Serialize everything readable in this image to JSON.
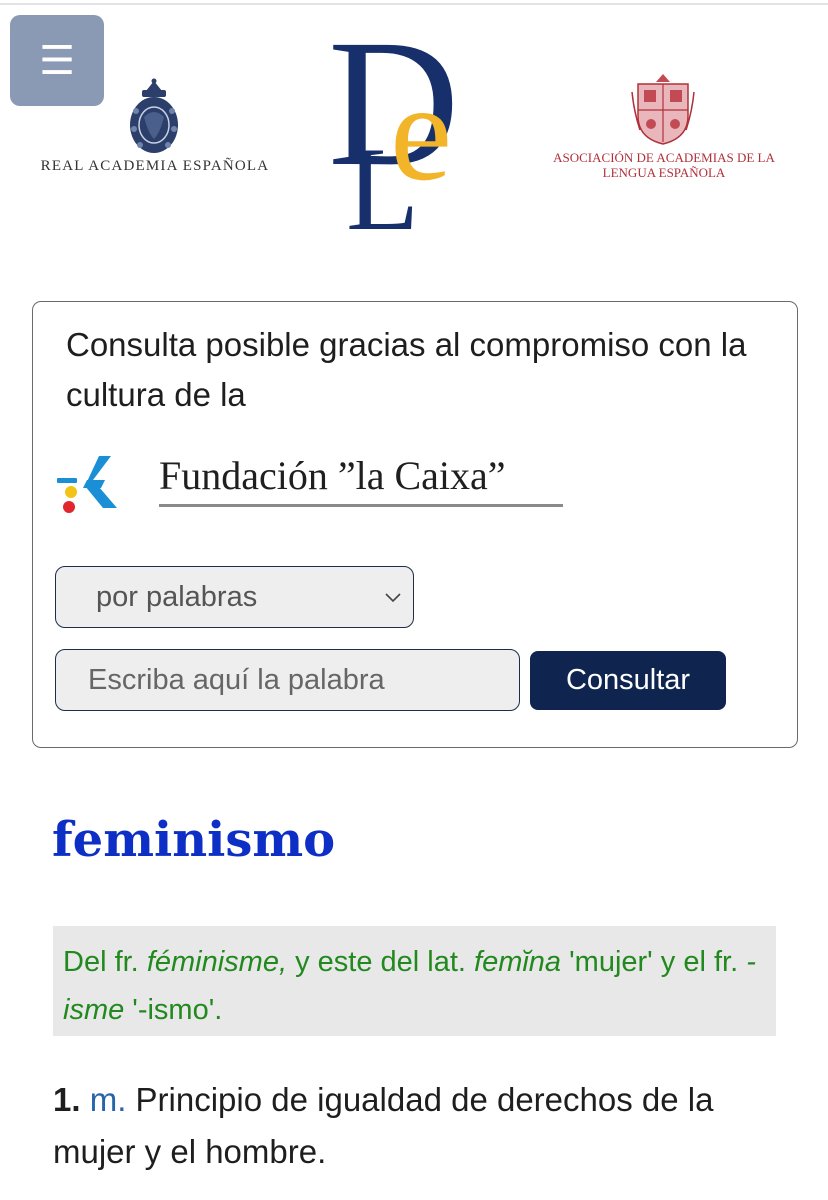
{
  "header": {
    "menu_icon": "menu-icon",
    "menu_glyph": "☰",
    "rae_name": "REAL ACADEMIA ESPAÑOLA",
    "dle_logo": {
      "letter_d": "D",
      "letter_e": "e",
      "letter_l": "L"
    },
    "asale_name_line1": "ASOCIACIÓN DE ACADEMIAS DE LA",
    "asale_name_line2": "LENGUA ESPAÑOLA"
  },
  "sponsor": {
    "text": "Consulta posible gracias al compromiso con la cultura de la",
    "foundation_name": "Fundación ”la Caixa”"
  },
  "search": {
    "mode_selected": "por palabras",
    "input_placeholder": "Escriba aquí la palabra",
    "button_label": "Consultar"
  },
  "entry": {
    "headword": "feminismo",
    "etymology": {
      "p1": "Del fr. ",
      "i1": "féminisme,",
      "p2": " y este del lat. ",
      "i2": "femĭna",
      "p3": " 'mujer' y el fr. ",
      "i3": "-isme",
      "p4": " '-ismo'."
    },
    "definitions": [
      {
        "number": "1.",
        "abbr": "m.",
        "text": " Principio de igualdad de derechos de la mujer y el hombre."
      }
    ]
  },
  "colors": {
    "headword": "#0e2fc6",
    "etymology_text": "#22891e",
    "etymology_bg": "#e8e8e8",
    "button_bg": "#0f2550",
    "menu_bg": "#8a9ab4",
    "dle_blue": "#17306b",
    "dle_gold": "#f2b52a",
    "asale_red": "#b0303a"
  }
}
